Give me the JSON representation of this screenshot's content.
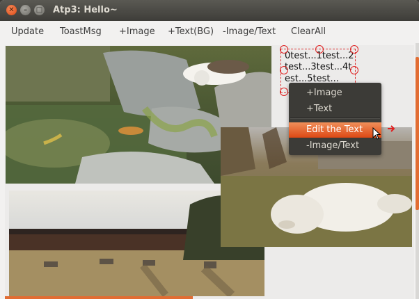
{
  "window": {
    "title": "Atp3: Hello~"
  },
  "toolbar": {
    "items": [
      "Update",
      "ToastMsg",
      "+Image",
      "+Text(BG)",
      "-Image/Text",
      "ClearAll"
    ]
  },
  "textbox": {
    "lines": [
      "0test...1test...2",
      "test...3test...4t",
      "est...5test..."
    ]
  },
  "context_menu": {
    "items": [
      "+Image",
      "+Text",
      "Edit the Text",
      "-Image/Text"
    ],
    "highlighted": "Edit the Text"
  },
  "photos": [
    "creek-with-cat",
    "white-dog-on-grass",
    "courtyard-at-dusk"
  ],
  "colors": {
    "accent": "#dd4814",
    "titlebar": "#3c3b37",
    "handle": "#e02020"
  }
}
